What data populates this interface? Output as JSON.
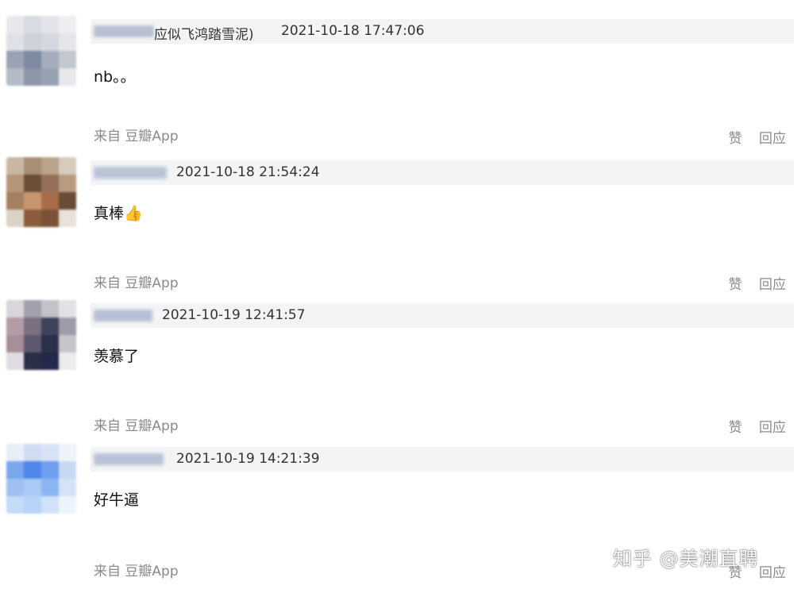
{
  "comments": [
    {
      "user_suffix": "应似飞鸿踏雪泥)",
      "timestamp": "2021-10-18 17:47:06",
      "text": "nb。。",
      "source": "来自 豆瓣App",
      "like_label": "赞",
      "reply_label": "回应"
    },
    {
      "user_suffix": "",
      "timestamp": "2021-10-18 21:54:24",
      "text": "真棒",
      "emoji": "👍",
      "source": "来自 豆瓣App",
      "like_label": "赞",
      "reply_label": "回应"
    },
    {
      "user_suffix": "",
      "timestamp": "2021-10-19 12:41:57",
      "text": "羡慕了",
      "source": "来自 豆瓣App",
      "like_label": "赞",
      "reply_label": "回应"
    },
    {
      "user_suffix": "",
      "timestamp": "2021-10-19 14:21:39",
      "text": "好牛逼",
      "source": "来自 豆瓣App",
      "like_label": "赞",
      "reply_label": "回应"
    },
    {
      "source": "来自 豆瓣App",
      "like_label": "赞",
      "reply_label": "回应"
    }
  ],
  "watermark": "知乎 @美潮直聘",
  "colors": {
    "meta_bar_bg": "#f3f4f5",
    "muted_text": "#8a8a8a",
    "body_text": "#111111"
  }
}
